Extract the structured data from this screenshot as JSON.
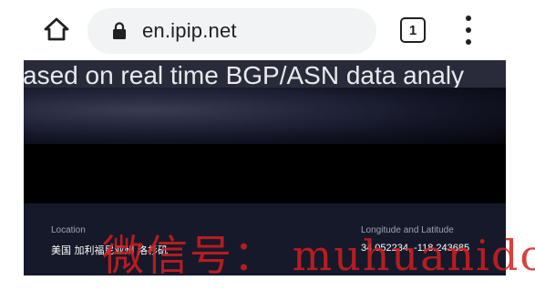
{
  "browser": {
    "url": "en.ipip.net",
    "tab_count": "1",
    "icons": {
      "home": "home-icon",
      "lock": "lock-icon",
      "tabs": "tab-switcher-icon",
      "menu": "more-vert-icon"
    }
  },
  "page": {
    "headline": "ased on real time BGP/ASN data analy",
    "location_label": "Location",
    "location_value": "美国 加利福尼亚州 洛杉矶",
    "coords_label": "Longitude and Latitude",
    "coords_value": "34.052234, -118.243685"
  },
  "overlay": {
    "watermark": "微信号： muhuanidc"
  },
  "colors": {
    "page_background": "#000000",
    "info_band": "#16192a",
    "watermark": "#d21e1e",
    "omnibox": "#f1f3f4"
  }
}
